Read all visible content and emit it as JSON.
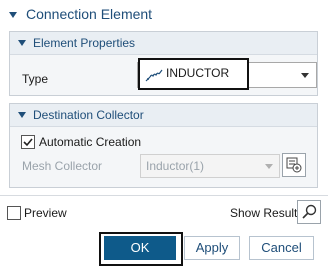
{
  "section": {
    "title": "Connection Element"
  },
  "element_properties": {
    "title": "Element Properties",
    "type_label": "Type",
    "type_value": "INDUCTOR"
  },
  "destination_collector": {
    "title": "Destination Collector",
    "auto_label": "Automatic Creation",
    "auto_checked": true,
    "mesh_label": "Mesh Collector",
    "mesh_value": "Inductor(1)"
  },
  "footer": {
    "preview_label": "Preview",
    "preview_checked": false,
    "show_result_label": "Show Result",
    "ok_label": "OK",
    "apply_label": "Apply",
    "cancel_label": "Cancel"
  },
  "icons": [
    "collapse-triangle-icon",
    "inductor-icon",
    "dropdown-arrow-icon",
    "checkbox-check-icon",
    "collector-add-icon",
    "magnifier-icon"
  ],
  "colors": {
    "accent": "#1f4e79",
    "primary_button": "#0e5a8a",
    "highlight_outline": "#111111"
  }
}
